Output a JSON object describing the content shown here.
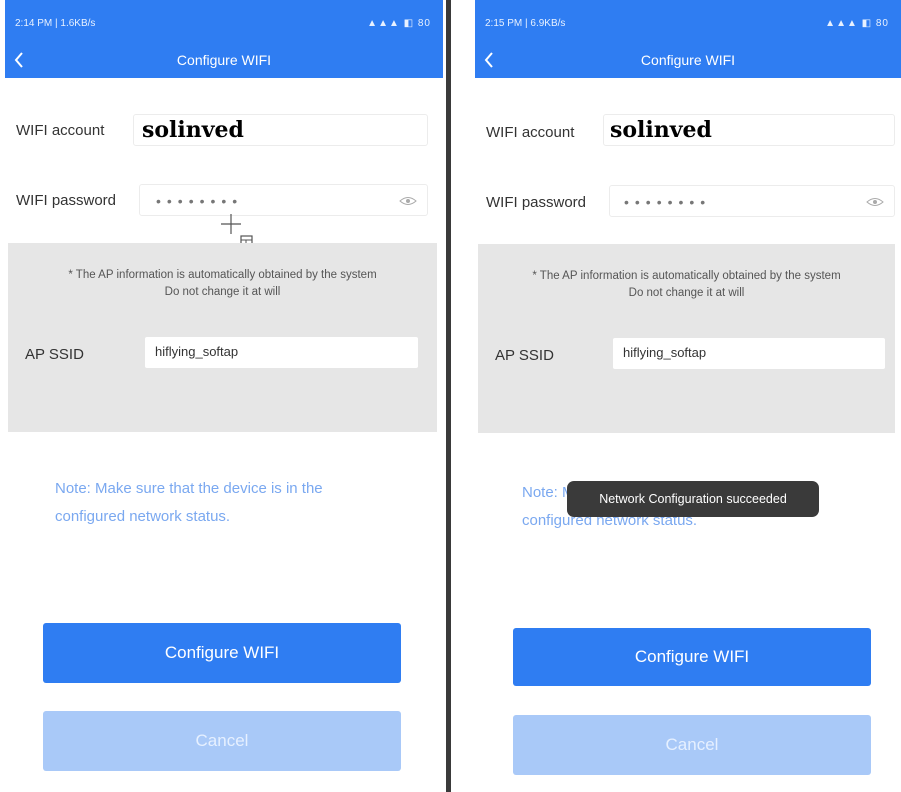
{
  "left": {
    "status": {
      "time": "2:14 PM | 1.6KB/s",
      "icons": "▲▲▲ ◧ 80"
    },
    "title": "Configure WIFI",
    "wifi_account": {
      "label": "WIFI account",
      "value": "solinved"
    },
    "wifi_password": {
      "label": "WIFI password",
      "value": "••••••••"
    },
    "ap_info_line1": "* The AP information is automatically obtained by the system",
    "ap_info_line2": "Do not change it at will",
    "ap_ssid": {
      "label": "AP SSID",
      "value": "hiflying_softap"
    },
    "note_line1": "Note: Make sure that the device is in the",
    "note_line2": "configured network status.",
    "configure_button": "Configure WIFI",
    "cancel_button": "Cancel"
  },
  "right": {
    "status": {
      "time": "2:15 PM | 6.9KB/s",
      "icons": "▲▲▲ ◧ 80"
    },
    "title": "Configure WIFI",
    "wifi_account": {
      "label": "WIFI account",
      "value": "solinved"
    },
    "wifi_password": {
      "label": "WIFI password",
      "value": "••••••••"
    },
    "ap_info_line1": "* The AP information is automatically obtained by the system",
    "ap_info_line2": "Do not change it at will",
    "ap_ssid": {
      "label": "AP SSID",
      "value": "hiflying_softap"
    },
    "note_line1": "Note: Make sure that the device is in the",
    "note_line2": "configured network status.",
    "toast": "Network Configuration succeeded",
    "configure_button": "Configure WIFI",
    "cancel_button": "Cancel"
  },
  "colors": {
    "primary": "#2f7df2",
    "primary_disabled": "#a9c9f8",
    "panel_bg": "#e6e6e6",
    "note_text": "#7aa8f0",
    "toast_bg": "#3a3a3a"
  },
  "icons": {
    "back": "chevron-left-icon",
    "password_toggle": "eye-icon",
    "cursor": "crosshair-cursor-icon"
  }
}
